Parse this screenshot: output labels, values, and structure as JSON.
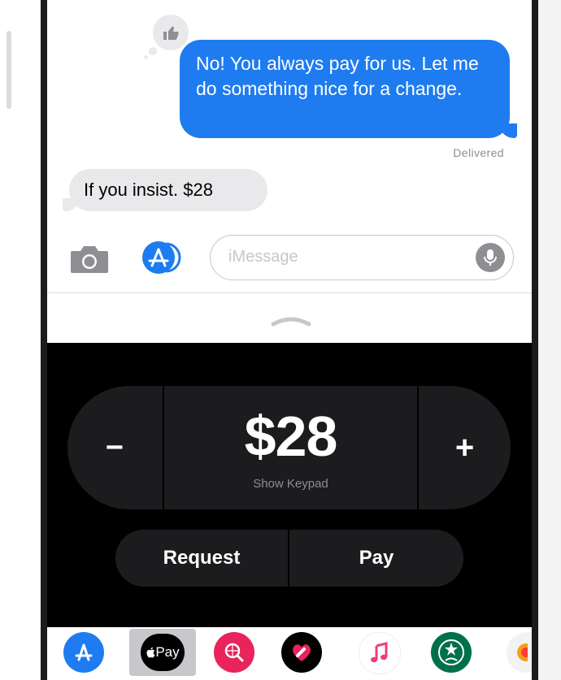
{
  "conversation": {
    "tapback_icon": "thumbs-up-icon",
    "outgoing_message": "No! You always pay for us. Let me do something nice for a change.",
    "status": "Delivered",
    "incoming_message": "If you insist. $28"
  },
  "compose": {
    "placeholder": "iMessage",
    "camera_icon": "camera-icon",
    "apps_icon": "app-store-icon",
    "mic_icon": "microphone-icon"
  },
  "apple_pay": {
    "amount": "$28",
    "minus_label": "−",
    "plus_label": "+",
    "keypad_label": "Show Keypad",
    "request_label": "Request",
    "pay_label": "Pay"
  },
  "app_drawer": {
    "items": [
      {
        "name": "app-store-icon"
      },
      {
        "name": "apple-pay",
        "label": "Pay"
      },
      {
        "name": "web-search-icon"
      },
      {
        "name": "digital-touch-icon"
      },
      {
        "name": "music-icon"
      },
      {
        "name": "starbucks-icon"
      },
      {
        "name": "partial-app-icon"
      }
    ]
  },
  "colors": {
    "bubble_out": "#1e7cf0",
    "bubble_in": "#e9e9eb",
    "panel": "#000000",
    "pill": "#1c1c1e"
  }
}
